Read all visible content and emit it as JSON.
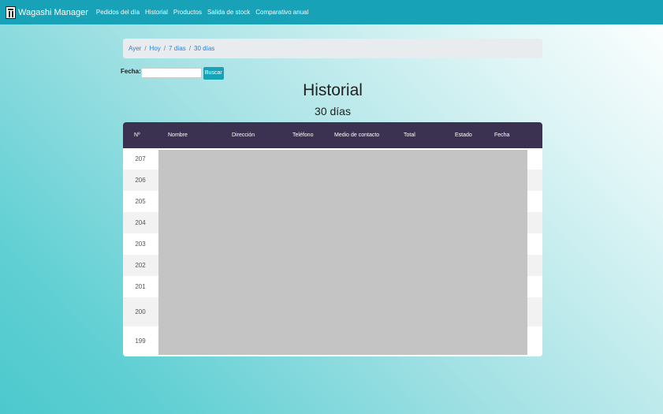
{
  "navbar": {
    "brand": "Wagashi Manager",
    "links": [
      "Pedidos del día",
      "Historial",
      "Productos",
      "Salida de stock",
      "Comparativo anual"
    ]
  },
  "breadcrumb": [
    "Ayer",
    "Hoy",
    "7 días",
    "30 días"
  ],
  "search": {
    "label": "Fecha:",
    "value": "",
    "button": "Buscar"
  },
  "main": {
    "title": "Historial",
    "subtitle": "30 días"
  },
  "table": {
    "headers": [
      "Nº",
      "Nombre",
      "Dirección",
      "Teléfono",
      "Medio de contacto",
      "Total",
      "Estado",
      "Fecha"
    ],
    "rows": [
      "207",
      "206",
      "205",
      "204",
      "203",
      "202",
      "201",
      "200",
      "199"
    ]
  }
}
